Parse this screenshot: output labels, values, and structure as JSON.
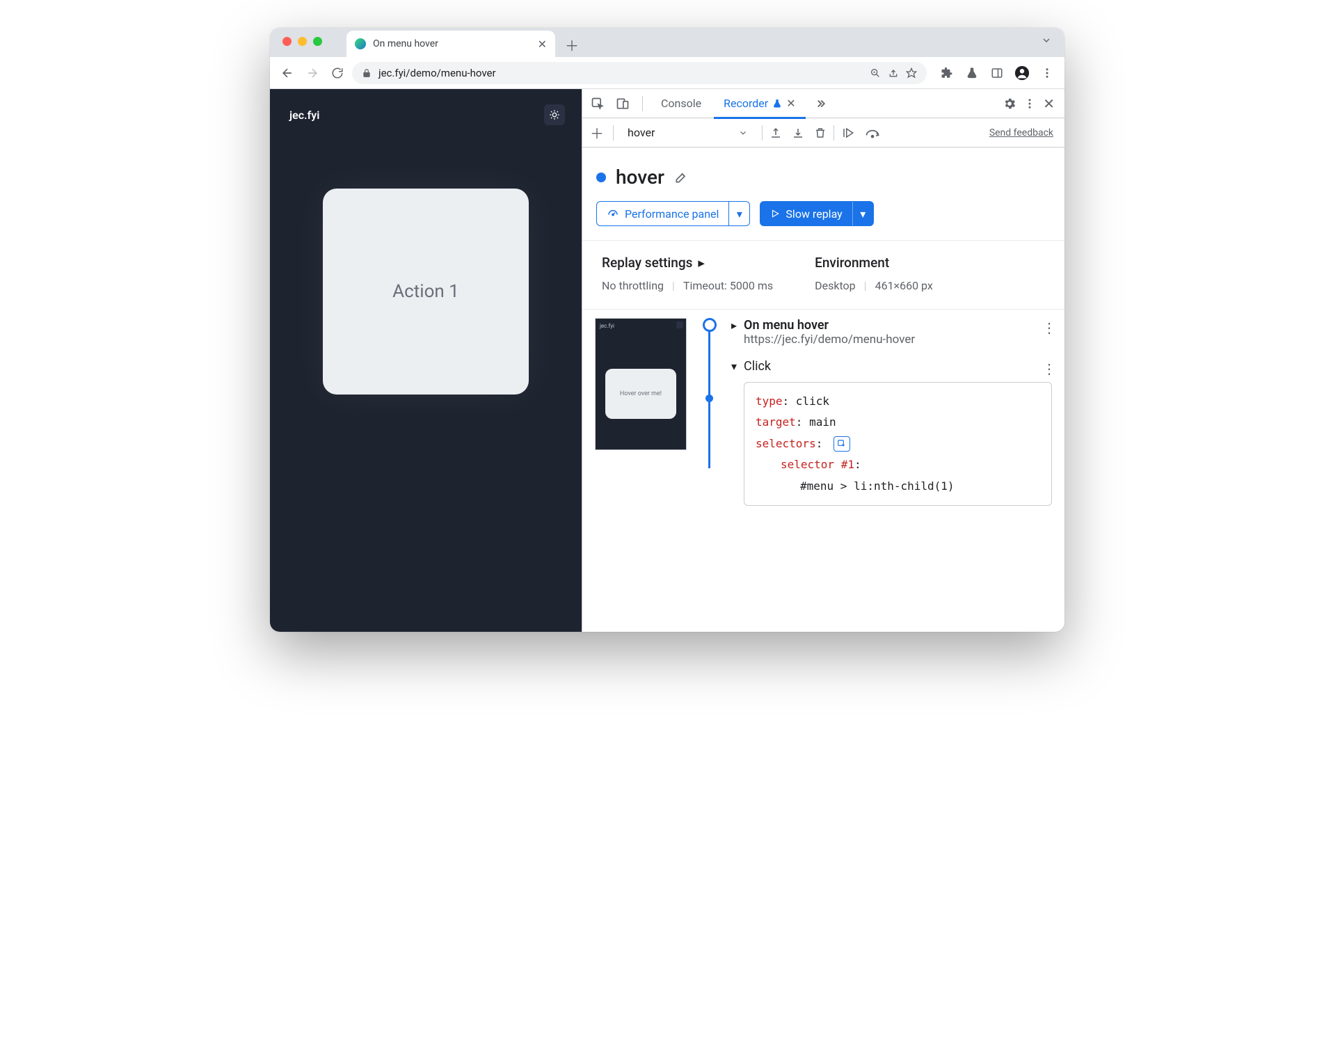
{
  "browser_tab": {
    "title": "On menu hover"
  },
  "omnibox": {
    "url": "jec.fyi/demo/menu-hover"
  },
  "page": {
    "brand": "jec.fyi",
    "card_text": "Action 1",
    "thumb_text": "Hover over me!"
  },
  "devtools": {
    "tabs": {
      "console": "Console",
      "recorder": "Recorder"
    },
    "recording_name": "hover",
    "feedback": "Send feedback",
    "title": "hover",
    "perf_btn": "Performance panel",
    "replay_btn": "Slow replay",
    "settings": {
      "header": "Replay settings",
      "throttle": "No throttling",
      "timeout": "Timeout: 5000 ms",
      "env_header": "Environment",
      "env_device": "Desktop",
      "env_dims": "461×660 px"
    },
    "step_nav": {
      "title": "On menu hover",
      "url": "https://jec.fyi/demo/menu-hover"
    },
    "step_click": {
      "label": "Click",
      "type_k": "type",
      "type_v": "click",
      "target_k": "target",
      "target_v": "main",
      "selectors_k": "selectors",
      "sel_label": "selector #1",
      "sel_value": "#menu > li:nth-child(1)"
    }
  }
}
